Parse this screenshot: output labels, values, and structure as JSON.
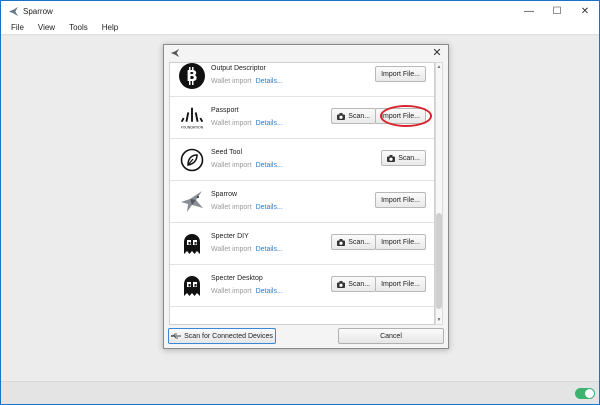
{
  "app": {
    "title": "Sparrow"
  },
  "window_controls": {
    "minimize": "—",
    "maximize": "☐",
    "close": "✕"
  },
  "menu": [
    "File",
    "View",
    "Tools",
    "Help"
  ],
  "dialog": {
    "close": "✕",
    "items": [
      {
        "name": "Output Descriptor",
        "sub": "Wallet import",
        "details": "Details...",
        "logo": "bitcoin-logo-icon",
        "scan": false,
        "import": true
      },
      {
        "name": "Passport",
        "sub": "Wallet import",
        "details": "Details...",
        "logo": "foundation-passport-logo-icon",
        "logo_text": "FOUNDATION",
        "scan": true,
        "import": true,
        "highlighted": true
      },
      {
        "name": "Seed Tool",
        "sub": "Wallet import",
        "details": "Details...",
        "logo": "seedtool-leaf-icon",
        "scan": true,
        "import": false
      },
      {
        "name": "Sparrow",
        "sub": "Wallet import",
        "details": "Details...",
        "logo": "sparrow-bird-icon",
        "scan": false,
        "import": true
      },
      {
        "name": "Specter DIY",
        "sub": "Wallet import",
        "details": "Details...",
        "logo": "specter-ghost-icon",
        "scan": true,
        "import": true
      },
      {
        "name": "Specter Desktop",
        "sub": "Wallet import",
        "details": "Details...",
        "logo": "specter-ghost-icon",
        "scan": true,
        "import": true
      }
    ],
    "scan_label": "Scan...",
    "import_label": "Import File...",
    "scan_devices_label": "Scan for Connected Devices",
    "cancel_label": "Cancel"
  },
  "colors": {
    "accent": "#2a7fd4",
    "highlight": "#d8222a",
    "toggle_on": "#3cb371",
    "window_border": "#1a73c9"
  }
}
